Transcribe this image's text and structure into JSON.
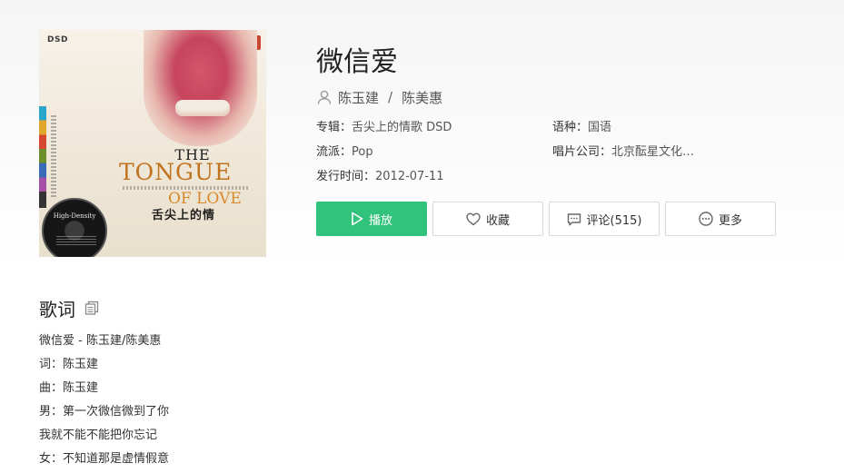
{
  "cover": {
    "badge": "DSD",
    "title_line1": "THE",
    "title_line2": "TONGUE",
    "title_line3": "OF LOVE",
    "title_cn": "舌尖上的情",
    "disc_label": "High-Density"
  },
  "song": {
    "title": "微信爱",
    "artists": [
      "陈玉建",
      "陈美惠"
    ],
    "artist_separator": "/"
  },
  "meta": {
    "album_label": "专辑：",
    "album_value": "舌尖上的情歌 DSD",
    "language_label": "语种：",
    "language_value": "国语",
    "genre_label": "流派：",
    "genre_value": "Pop",
    "company_label": "唱片公司：",
    "company_value": "北京酝星文化…",
    "release_label": "发行时间：",
    "release_value": "2012-07-11"
  },
  "actions": {
    "play": "播放",
    "favorite": "收藏",
    "comment": "评论(515)",
    "more": "更多"
  },
  "lyrics": {
    "heading": "歌词",
    "lines": [
      "微信爱 - 陈玉建/陈美惠",
      "词：陈玉建",
      "曲：陈玉建",
      "男：第一次微信微到了你",
      "我就不能不能把你忘记",
      "女：不知道那是虚情假意"
    ]
  },
  "colors": {
    "accent": "#31c27c",
    "text": "#333333",
    "border": "#d8d8d8"
  },
  "icons": {
    "artist": "person-icon",
    "play": "play-icon",
    "favorite": "heart-icon",
    "comment": "comment-icon",
    "more": "more-dots-icon",
    "copy": "copy-icon"
  }
}
